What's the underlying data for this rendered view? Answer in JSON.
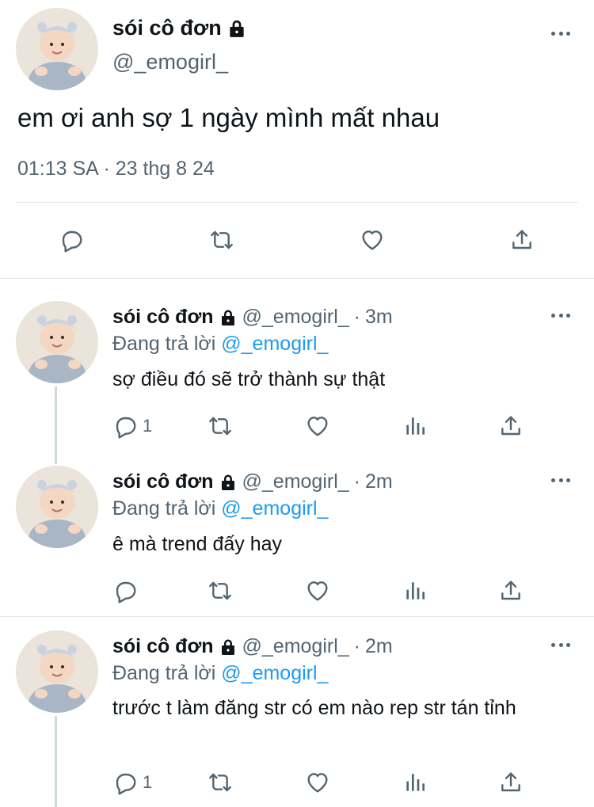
{
  "main_tweet": {
    "author_name": "sói cô đơn",
    "author_handle": "@_emogirl_",
    "text": "em ơi anh sợ 1 ngày mình mất nhau",
    "time": "01:13 SA",
    "separator": "·",
    "date": "23 thg 8 24",
    "actions": [
      "reply-icon",
      "retweet-icon",
      "like-icon",
      "share-icon"
    ]
  },
  "replies": [
    {
      "author_name": "sói cô đơn",
      "author_handle": "@_emogirl_",
      "separator": "·",
      "time": "3m",
      "replying_prefix": "Đang trả lời",
      "replying_to": "@_emogirl_",
      "text": "sợ điều đó sẽ trở thành sự thật",
      "reply_count": "1"
    },
    {
      "author_name": "sói cô đơn",
      "author_handle": "@_emogirl_",
      "separator": "·",
      "time": "2m",
      "replying_prefix": "Đang trả lời",
      "replying_to": "@_emogirl_",
      "text": "ê mà trend đấy hay",
      "reply_count": ""
    },
    {
      "author_name": "sói cô đơn",
      "author_handle": "@_emogirl_",
      "separator": "·",
      "time": "2m",
      "replying_prefix": "Đang trả lời",
      "replying_to": "@_emogirl_",
      "text": "trước t làm đăng str có em nào rep str tán tỉnh",
      "reply_count": "1"
    }
  ],
  "colors": {
    "text": "#0f1419",
    "secondary": "#536471",
    "link": "#1d9bf0",
    "divider": "#e1e6ea"
  }
}
